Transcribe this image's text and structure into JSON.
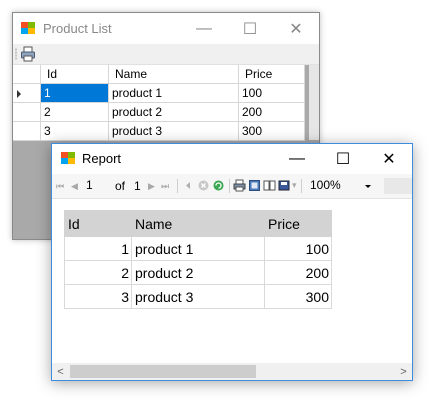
{
  "product_window": {
    "title": "Product List",
    "columns": [
      "Id",
      "Name",
      "Price"
    ],
    "rows": [
      {
        "id": "1",
        "name": "product 1",
        "price": "100",
        "selected": true
      },
      {
        "id": "2",
        "name": "product 2",
        "price": "200",
        "selected": false
      },
      {
        "id": "3",
        "name": "product 3",
        "price": "300",
        "selected": false
      }
    ],
    "minimize_glyph": "—",
    "maximize_glyph": "☐",
    "close_glyph": "✕"
  },
  "report_window": {
    "title": "Report",
    "minimize_glyph": "—",
    "maximize_glyph": "☐",
    "close_glyph": "✕",
    "toolbar": {
      "first_glyph": "⏮",
      "prev_glyph": "◀",
      "current_page": "1",
      "of_label": "of",
      "total_pages": "1",
      "next_glyph": "▶",
      "last_glyph": "⏭",
      "zoom": "100%"
    },
    "table": {
      "columns": [
        "Id",
        "Name",
        "Price"
      ],
      "rows": [
        {
          "id": "1",
          "name": "product 1",
          "price": "100"
        },
        {
          "id": "2",
          "name": "product 2",
          "price": "200"
        },
        {
          "id": "3",
          "name": "product 3",
          "price": "300"
        }
      ]
    },
    "scroll_left_glyph": "<",
    "scroll_right_glyph": ">"
  },
  "colors": {
    "selection": "#0078d7",
    "report_border": "#3c8edc",
    "grid_background": "#a9a9a9",
    "report_header": "#d3d3d3"
  },
  "icons": {
    "app_icon": "winforms-app-icon",
    "print": "printer-icon",
    "report_toolbar": [
      "back-icon",
      "stop-icon",
      "refresh-icon",
      "print-icon",
      "print-layout-icon",
      "page-setup-icon",
      "export-icon"
    ]
  }
}
